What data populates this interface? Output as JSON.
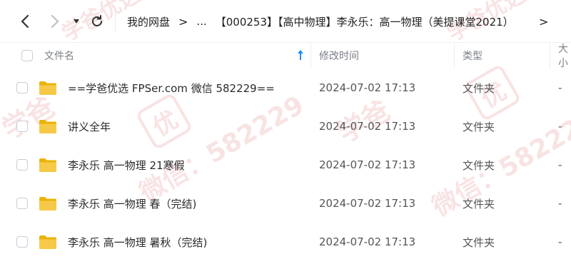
{
  "navbar": {
    "back_icon": "chevron-left-icon",
    "forward_icon": "chevron-right-icon",
    "dropdown_icon": "caret-down-icon",
    "refresh_icon": "refresh-icon"
  },
  "breadcrumb": {
    "root": "我的网盘",
    "separator": ">",
    "ellipsis": "...",
    "current": "【000253】【高中物理】李永乐：高一物理（美提课堂2021）",
    "more": ">"
  },
  "table": {
    "headers": {
      "name": "文件名",
      "mtime": "修改时间",
      "type": "类型",
      "size": "大小"
    },
    "sort_icon": "sort-up-arrow-icon",
    "rows": [
      {
        "name": "==学爸优选 FPSer.com 微信 582229==",
        "mtime": "2024-07-02 17:13",
        "type": "文件夹",
        "size": "-"
      },
      {
        "name": "讲义全年",
        "mtime": "2024-07-02 17:13",
        "type": "文件夹",
        "size": "-"
      },
      {
        "name": "李永乐 高一物理 21寒假",
        "mtime": "2024-07-02 17:13",
        "type": "文件夹",
        "size": "-"
      },
      {
        "name": "李永乐 高一物理 春（完结)",
        "mtime": "2024-07-02 17:13",
        "type": "文件夹",
        "size": "-"
      },
      {
        "name": "李永乐 高一物理 暑秋（完结)",
        "mtime": "2024-07-02 17:13",
        "type": "文件夹",
        "size": "-"
      }
    ]
  },
  "colors": {
    "folder": "#f7c948",
    "folder_dark": "#eab308",
    "sort_arrow": "#1a8cff",
    "watermark": "#d25050"
  },
  "watermark": {
    "brand": "学爸",
    "stamp": "优",
    "text": "微信：582229",
    "text_short": "学爸优选"
  }
}
